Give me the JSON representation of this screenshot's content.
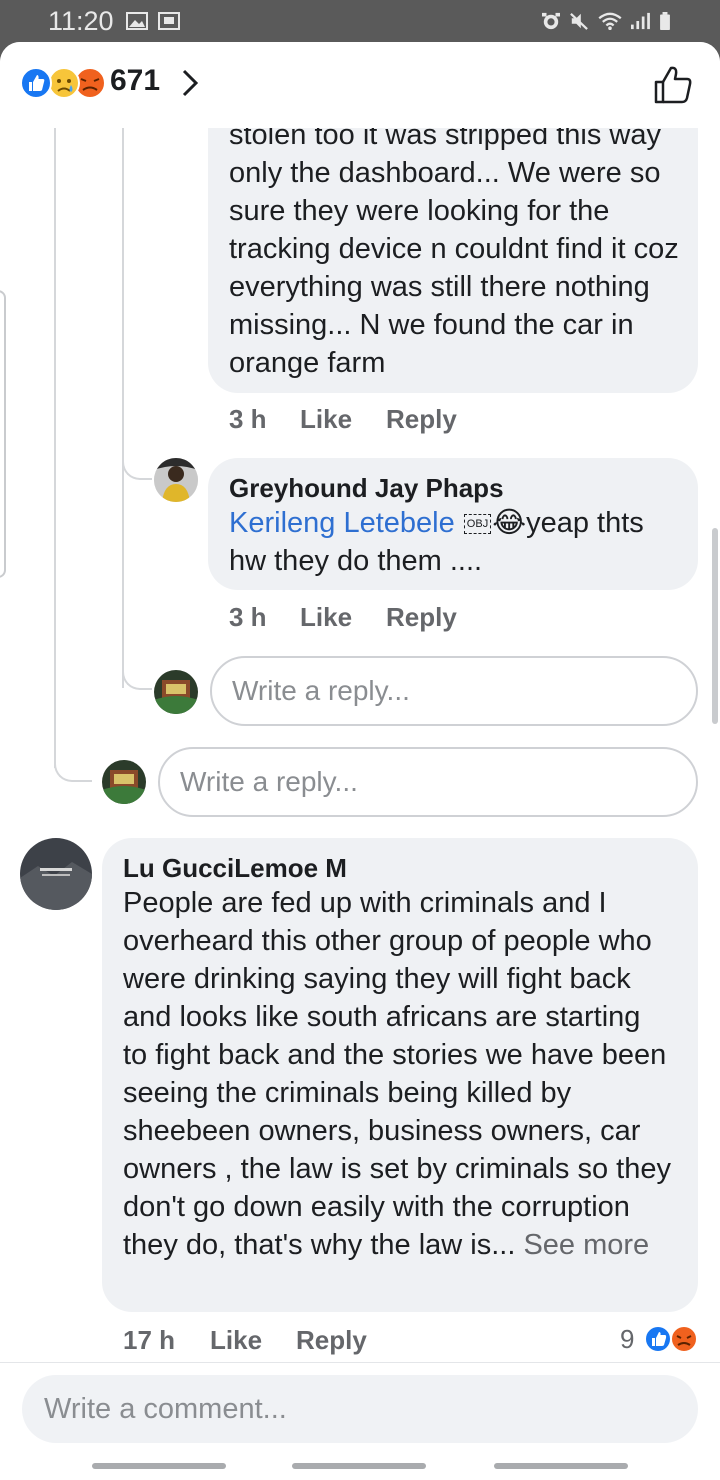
{
  "status_bar": {
    "time": "11:20"
  },
  "header": {
    "reaction_count": "671"
  },
  "comments": {
    "c1": {
      "body": "stolen too it was stripped this way only the dashboard... We were so sure they were looking for the tracking device n couldnt find it coz everything was still there nothing missing... N we found the car in orange farm",
      "time": "3 h",
      "like": "Like",
      "reply": "Reply"
    },
    "c2": {
      "author": "Greyhound Jay Phaps",
      "mention": "Kerileng Letebele",
      "obj": "OBJ",
      "emoji": "😂",
      "body": "yeap thts hw they do them ....",
      "time": "3 h",
      "like": "Like",
      "reply": "Reply"
    },
    "c3": {
      "author": "Lu GucciLemoe M",
      "body": "People are fed up with criminals and I overheard this other group of people who were drinking saying they will fight back and looks like south africans are starting to fight back and the stories we have been seeing the criminals being killed by sheebeen owners, business owners, car owners , the law is set by criminals so they don't go down easily with the corruption they do, that's why the law is... ",
      "see_more": "See more",
      "time": "17 h",
      "like": "Like",
      "reply": "Reply",
      "reaction_count": "9"
    }
  },
  "reply_inputs": {
    "placeholder": "Write a reply..."
  },
  "composer": {
    "placeholder": "Write a comment..."
  },
  "colors": {
    "accent": "#2e6fd1",
    "bubble": "#eff1f4",
    "like_blue": "#1877f2",
    "angry": "#f0611e"
  }
}
